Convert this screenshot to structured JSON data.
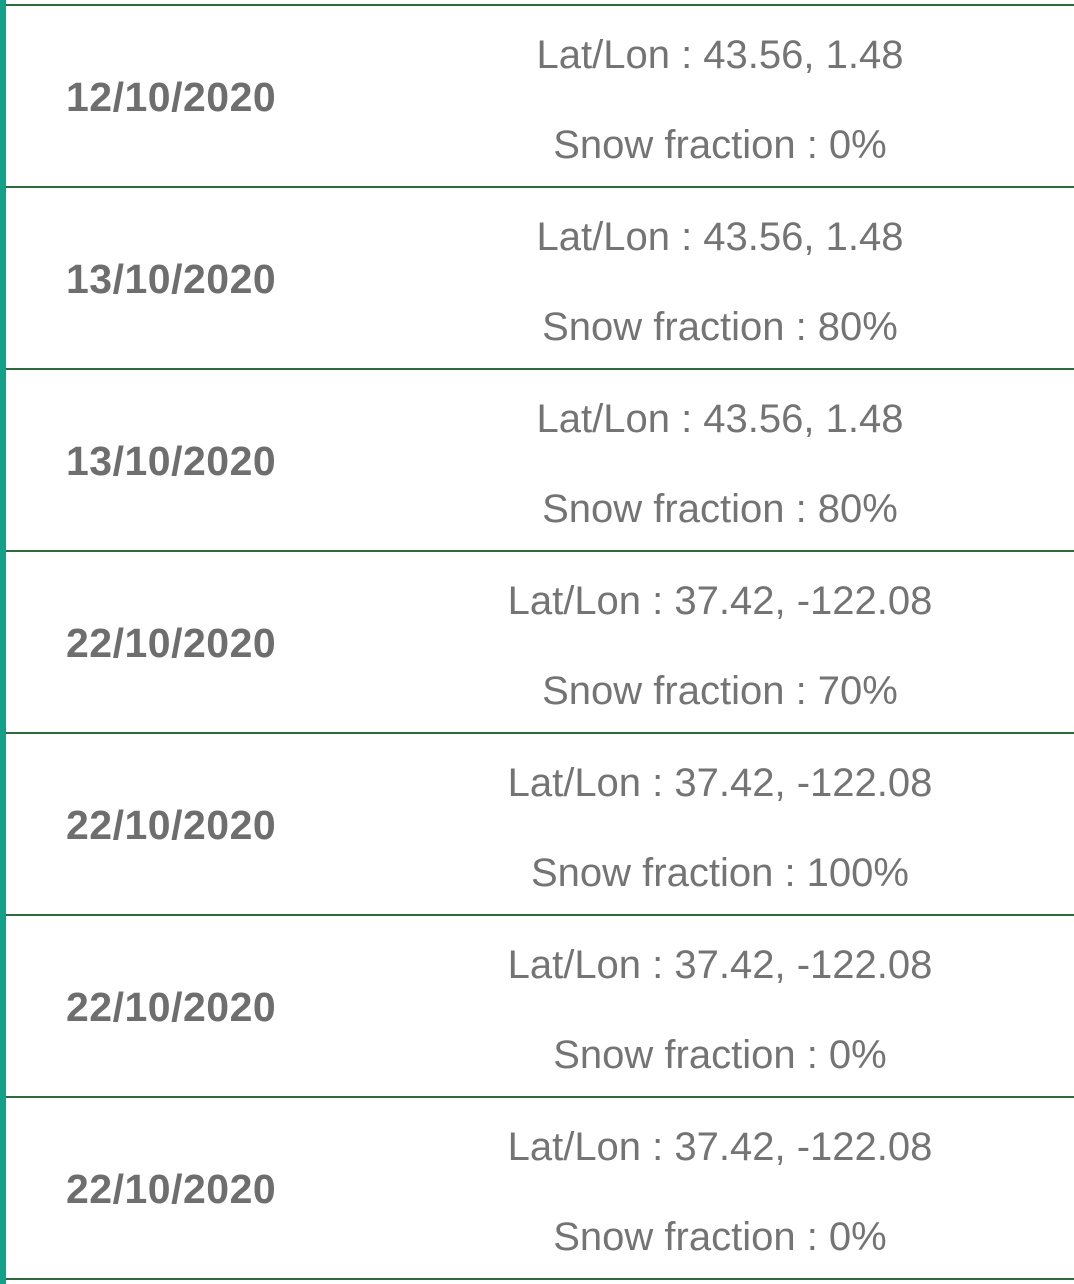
{
  "colors": {
    "accent_bar": "#12a08a",
    "divider": "#2e6b3a",
    "text_date": "#6e6e6e",
    "text_info": "#747474",
    "background": "#ffffff"
  },
  "history": {
    "items": [
      {
        "date": "12/10/2020",
        "latlon": "Lat/Lon : 43.56, 1.48",
        "snow": "Snow fraction : 0%"
      },
      {
        "date": "13/10/2020",
        "latlon": "Lat/Lon : 43.56, 1.48",
        "snow": "Snow fraction : 80%"
      },
      {
        "date": "13/10/2020",
        "latlon": "Lat/Lon : 43.56, 1.48",
        "snow": "Snow fraction : 80%"
      },
      {
        "date": "22/10/2020",
        "latlon": "Lat/Lon : 37.42, -122.08",
        "snow": "Snow fraction : 70%"
      },
      {
        "date": "22/10/2020",
        "latlon": "Lat/Lon : 37.42, -122.08",
        "snow": "Snow fraction : 100%"
      },
      {
        "date": "22/10/2020",
        "latlon": "Lat/Lon : 37.42, -122.08",
        "snow": "Snow fraction : 0%"
      },
      {
        "date": "22/10/2020",
        "latlon": "Lat/Lon : 37.42, -122.08",
        "snow": "Snow fraction : 0%"
      }
    ]
  }
}
